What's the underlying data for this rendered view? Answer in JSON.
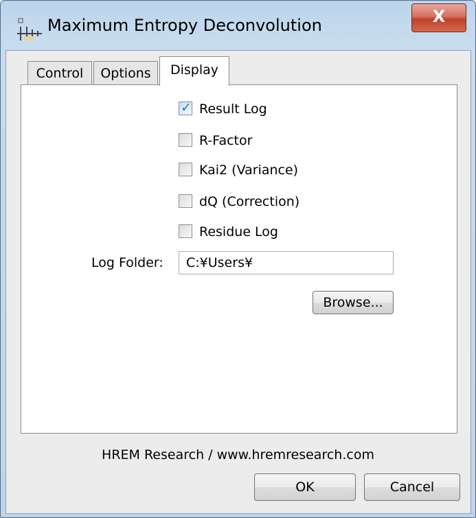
{
  "window": {
    "title": "Maximum Entropy Deconvolution",
    "close_glyph": "X"
  },
  "tabs": [
    {
      "label": "Control",
      "active": false
    },
    {
      "label": "Options",
      "active": false
    },
    {
      "label": "Display",
      "active": true
    }
  ],
  "display": {
    "checkboxes": [
      {
        "label": "Result Log",
        "checked": true
      },
      {
        "label": "R-Factor",
        "checked": false
      },
      {
        "label": "Kai2 (Variance)",
        "checked": false
      },
      {
        "label": "dQ (Correction)",
        "checked": false
      },
      {
        "label": "Residue Log",
        "checked": false
      }
    ],
    "log_folder_label": "Log Folder:",
    "log_folder_value": "C:¥Users¥",
    "browse_label": "Browse..."
  },
  "footer": {
    "credit": "HREM Research / www.hremresearch.com",
    "ok_label": "OK",
    "cancel_label": "Cancel"
  },
  "icons": {
    "app_icon": "app-icon",
    "check": "✓"
  }
}
